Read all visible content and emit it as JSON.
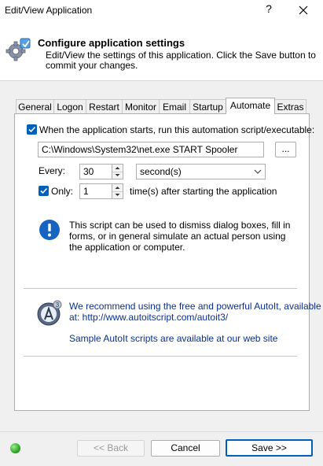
{
  "window": {
    "title": "Edit/View Application",
    "help_glyph": "?",
    "close_glyph": "✕"
  },
  "header": {
    "title": "Configure application settings",
    "description": "Edit/View the settings of this application. Click the Save button to commit your changes."
  },
  "tabs": [
    {
      "label": "General"
    },
    {
      "label": "Logon"
    },
    {
      "label": "Restart"
    },
    {
      "label": "Monitor"
    },
    {
      "label": "Email"
    },
    {
      "label": "Startup"
    },
    {
      "label": "Automate",
      "active": true
    },
    {
      "label": "Extras"
    }
  ],
  "automate": {
    "run_script_checked": true,
    "run_script_label": "When the application starts, run this automation script/executable:",
    "script_path": "C:\\Windows\\System32\\net.exe START Spooler",
    "browse_label": "...",
    "every_label": "Every:",
    "every_value": "30",
    "unit_value": "second(s)",
    "only_checked": true,
    "only_label": "Only:",
    "only_value": "1",
    "only_suffix": "time(s) after starting the application",
    "info_text": "This script can be used to dismiss dialog boxes, fill in forms, or in general simulate an actual person using the application or computer.",
    "autoit_line1": "We recommend using the free and powerful AutoIt, available",
    "autoit_line2": "at: http://www.autoitscript.com/autoit3/",
    "autoit_samples": "Sample AutoIt scripts are available at our web site"
  },
  "footer": {
    "back_label": "<< Back",
    "cancel_label": "Cancel",
    "save_label": "Save >>",
    "status_color": "#2ea52a"
  },
  "colors": {
    "accent": "#005fb8",
    "link_blue": "#0a2f8c",
    "info_blue": "#1565c0"
  }
}
